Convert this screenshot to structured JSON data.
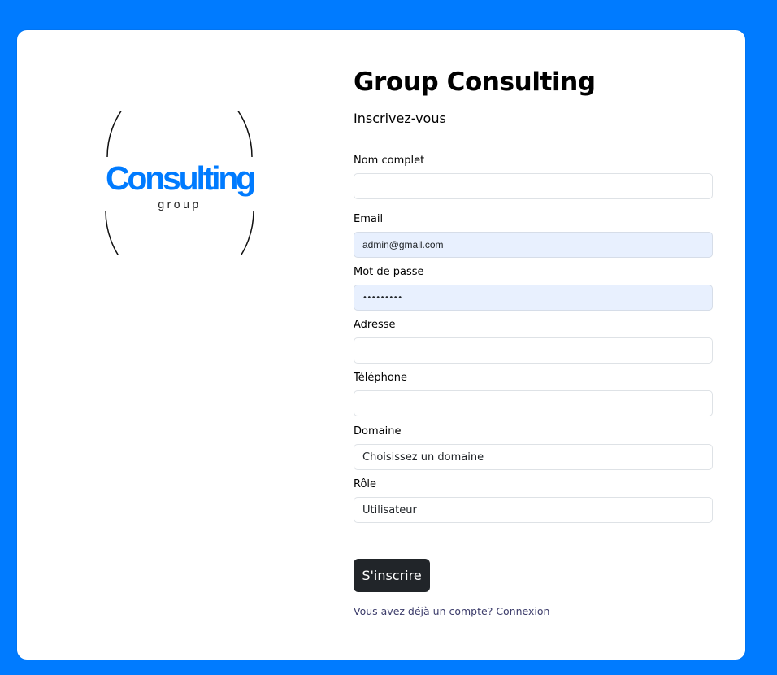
{
  "brand": {
    "logo_word": "Consulting",
    "logo_sub": "group",
    "logo_color": "#007bff"
  },
  "header": {
    "title": "Group Consulting",
    "subtitle": "Inscrivez-vous"
  },
  "form": {
    "full_name": {
      "label": "Nom complet",
      "value": ""
    },
    "email": {
      "label": "Email",
      "value": "admin@gmail.com"
    },
    "password": {
      "label": "Mot de passe",
      "value": "•••••••••"
    },
    "address": {
      "label": "Adresse",
      "value": ""
    },
    "phone": {
      "label": "Téléphone",
      "value": ""
    },
    "domain": {
      "label": "Domaine",
      "selected": "Choisissez un domaine"
    },
    "role": {
      "label": "Rôle",
      "selected": "Utilisateur"
    }
  },
  "actions": {
    "submit_label": "S'inscrire",
    "login_prompt": "Vous avez déjà un compte?",
    "login_link": "Connexion"
  },
  "colors": {
    "background": "#007bff",
    "button": "#212529",
    "autofill": "#e8f0fe"
  }
}
